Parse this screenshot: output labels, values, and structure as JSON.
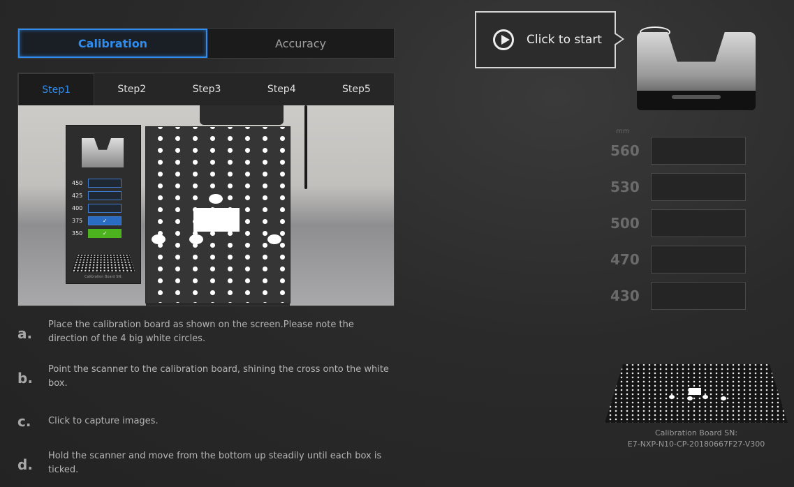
{
  "mode_tabs": [
    {
      "label": "Calibration",
      "active": true
    },
    {
      "label": "Accuracy",
      "active": false
    }
  ],
  "step_tabs": [
    {
      "label": "Step1",
      "active": true
    },
    {
      "label": "Step2",
      "active": false
    },
    {
      "label": "Step3",
      "active": false
    },
    {
      "label": "Step4",
      "active": false
    },
    {
      "label": "Step5",
      "active": false
    }
  ],
  "photo_screen": {
    "rows": [
      {
        "label": "450",
        "state": "empty",
        "mark": ""
      },
      {
        "label": "425",
        "state": "empty",
        "mark": ""
      },
      {
        "label": "400",
        "state": "empty",
        "mark": ""
      },
      {
        "label": "375",
        "state": "blue",
        "mark": "✓"
      },
      {
        "label": "350",
        "state": "green",
        "mark": "✓"
      }
    ],
    "caption": "Calibration Board SN:"
  },
  "instructions": [
    {
      "letter": "a.",
      "text": "Place the calibration board as shown on the screen.Please note the direction of the 4 big white circles."
    },
    {
      "letter": "b.",
      "text": "Point the scanner to the calibration board, shining the cross onto the white box."
    },
    {
      "letter": "c.",
      "text": "Click to capture images."
    },
    {
      "letter": "d.",
      "text": "Hold the scanner and move from the bottom up steadily until each box is ticked."
    }
  ],
  "start": {
    "label": "Click to start",
    "icon": "play-circle-icon"
  },
  "distance_unit": "mm",
  "distances": [
    "560",
    "530",
    "500",
    "470",
    "430"
  ],
  "board_sn": {
    "label": "Calibration Board SN:",
    "value": "E7-NXP-N10-CP-20180667F27-V300"
  },
  "colors": {
    "accent": "#2f8df0",
    "tick_green": "#4cb31f",
    "tick_blue": "#2a6cc2"
  }
}
